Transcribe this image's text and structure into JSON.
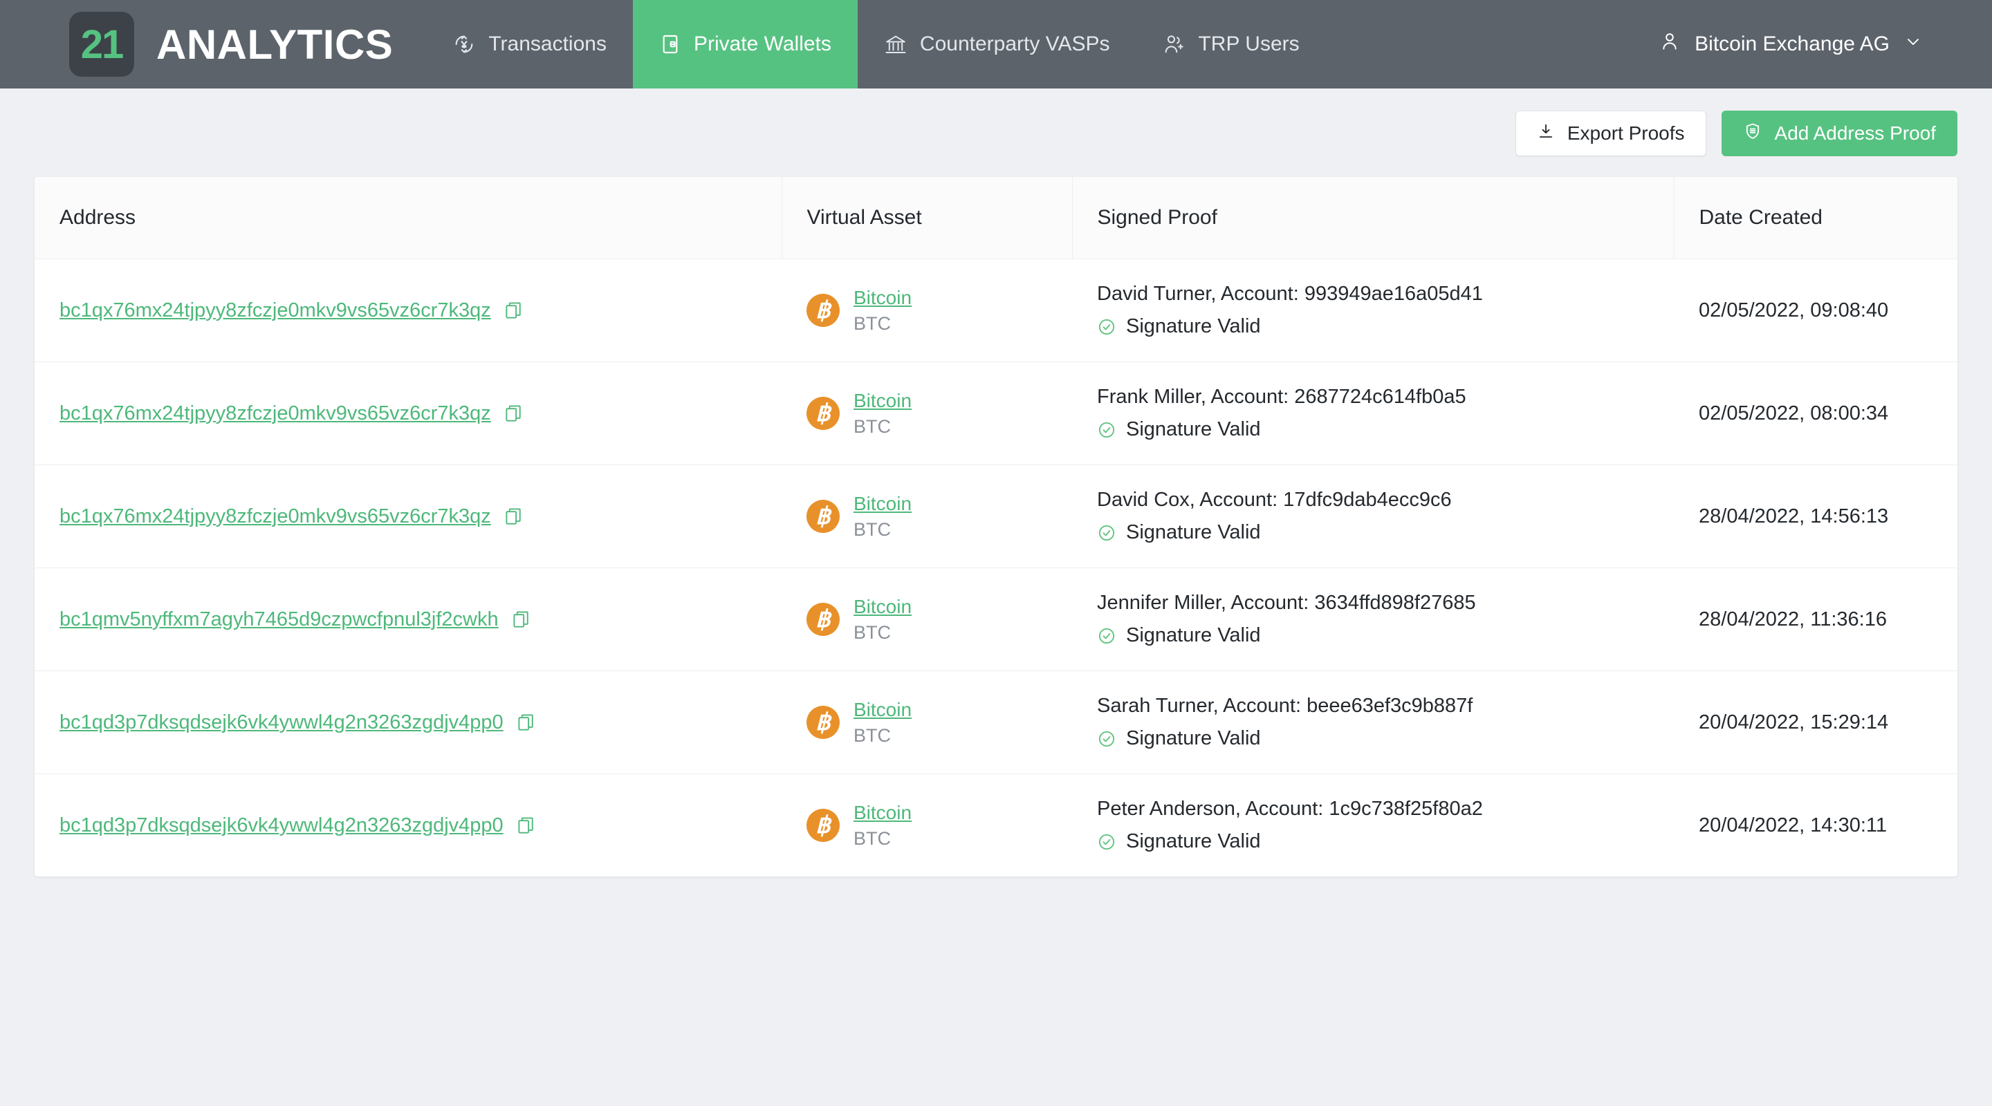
{
  "brand": {
    "mark": "21",
    "name": "ANALYTICS"
  },
  "nav": {
    "tabs": [
      {
        "label": "Transactions",
        "icon": "currency-exchange-icon",
        "active": false
      },
      {
        "label": "Private Wallets",
        "icon": "wallet-icon",
        "active": true
      },
      {
        "label": "Counterparty VASPs",
        "icon": "bank-icon",
        "active": false
      },
      {
        "label": "TRP Users",
        "icon": "users-icon",
        "active": false
      }
    ],
    "account": {
      "label": "Bitcoin Exchange AG",
      "icon": "person-icon",
      "chevron": "chevron-down-icon"
    }
  },
  "toolbar": {
    "export_label": "Export Proofs",
    "export_icon": "download-icon",
    "add_label": "Add Address Proof",
    "add_icon": "shield-check-icon"
  },
  "table": {
    "columns": [
      "Address",
      "Virtual Asset",
      "Signed Proof",
      "Date Created"
    ],
    "rows": [
      {
        "address": "bc1qx76mx24tjpyy8zfczje0mkv9vs65vz6cr7k3qz",
        "asset_name": "Bitcoin",
        "asset_symbol": "BTC",
        "proof": "David Turner, Account: 993949ae16a05d41",
        "signature": "Signature Valid",
        "date": "02/05/2022, 09:08:40"
      },
      {
        "address": "bc1qx76mx24tjpyy8zfczje0mkv9vs65vz6cr7k3qz",
        "asset_name": "Bitcoin",
        "asset_symbol": "BTC",
        "proof": "Frank Miller, Account: 2687724c614fb0a5",
        "signature": "Signature Valid",
        "date": "02/05/2022, 08:00:34"
      },
      {
        "address": "bc1qx76mx24tjpyy8zfczje0mkv9vs65vz6cr7k3qz",
        "asset_name": "Bitcoin",
        "asset_symbol": "BTC",
        "proof": "David Cox, Account: 17dfc9dab4ecc9c6",
        "signature": "Signature Valid",
        "date": "28/04/2022, 14:56:13"
      },
      {
        "address": "bc1qmv5nyffxm7agyh7465d9czpwcfpnul3jf2cwkh",
        "asset_name": "Bitcoin",
        "asset_symbol": "BTC",
        "proof": "Jennifer Miller, Account: 3634ffd898f27685",
        "signature": "Signature Valid",
        "date": "28/04/2022, 11:36:16"
      },
      {
        "address": "bc1qd3p7dksqdsejk6vk4ywwl4g2n3263zgdjv4pp0",
        "asset_name": "Bitcoin",
        "asset_symbol": "BTC",
        "proof": "Sarah Turner, Account: beee63ef3c9b887f",
        "signature": "Signature Valid",
        "date": "20/04/2022, 15:29:14"
      },
      {
        "address": "bc1qd3p7dksqdsejk6vk4ywwl4g2n3263zgdjv4pp0",
        "asset_name": "Bitcoin",
        "asset_symbol": "BTC",
        "proof": "Peter Anderson, Account: 1c9c738f25f80a2",
        "signature": "Signature Valid",
        "date": "20/04/2022, 14:30:11"
      }
    ]
  },
  "colors": {
    "header_bg": "#5c636b",
    "accent_green": "#56c281",
    "link_green": "#4db87a",
    "bitcoin_orange": "#e8912a",
    "page_bg": "#eff0f3"
  }
}
